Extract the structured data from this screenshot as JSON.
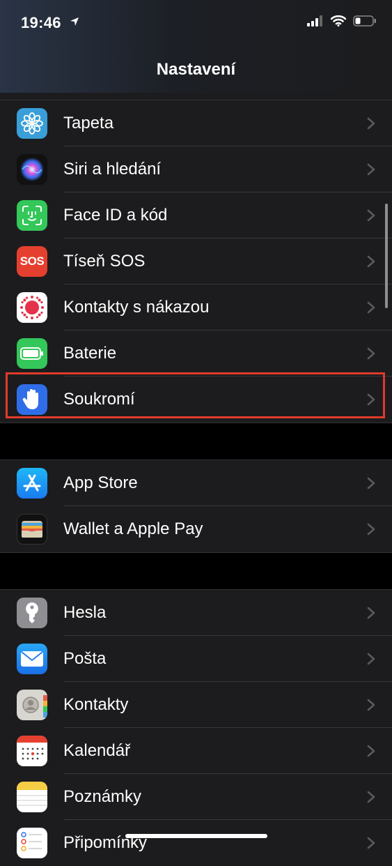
{
  "status_bar": {
    "time": "19:46"
  },
  "header": {
    "title": "Nastavení"
  },
  "groups": [
    {
      "items": [
        {
          "label": "Tapeta",
          "icon": "wallpaper-icon"
        },
        {
          "label": "Siri a hledání",
          "icon": "siri-icon"
        },
        {
          "label": "Face ID a kód",
          "icon": "face-id-icon"
        },
        {
          "label": "Tíseň SOS",
          "icon": "sos-icon",
          "icon_text": "SOS"
        },
        {
          "label": "Kontakty s nákazou",
          "icon": "exposure-icon"
        },
        {
          "label": "Baterie",
          "icon": "battery-icon"
        },
        {
          "label": "Soukromí",
          "icon": "privacy-hand-icon",
          "highlighted": true
        }
      ]
    },
    {
      "items": [
        {
          "label": "App Store",
          "icon": "app-store-icon"
        },
        {
          "label": "Wallet a Apple Pay",
          "icon": "wallet-icon"
        }
      ]
    },
    {
      "items": [
        {
          "label": "Hesla",
          "icon": "key-icon"
        },
        {
          "label": "Pošta",
          "icon": "mail-icon"
        },
        {
          "label": "Kontakty",
          "icon": "contacts-icon"
        },
        {
          "label": "Kalendář",
          "icon": "calendar-icon"
        },
        {
          "label": "Poznámky",
          "icon": "notes-icon"
        },
        {
          "label": "Připomínky",
          "icon": "reminders-icon"
        }
      ]
    }
  ],
  "colors": {
    "highlight": "#e03a2c",
    "background": "#000000",
    "cell": "#1c1c1e"
  }
}
